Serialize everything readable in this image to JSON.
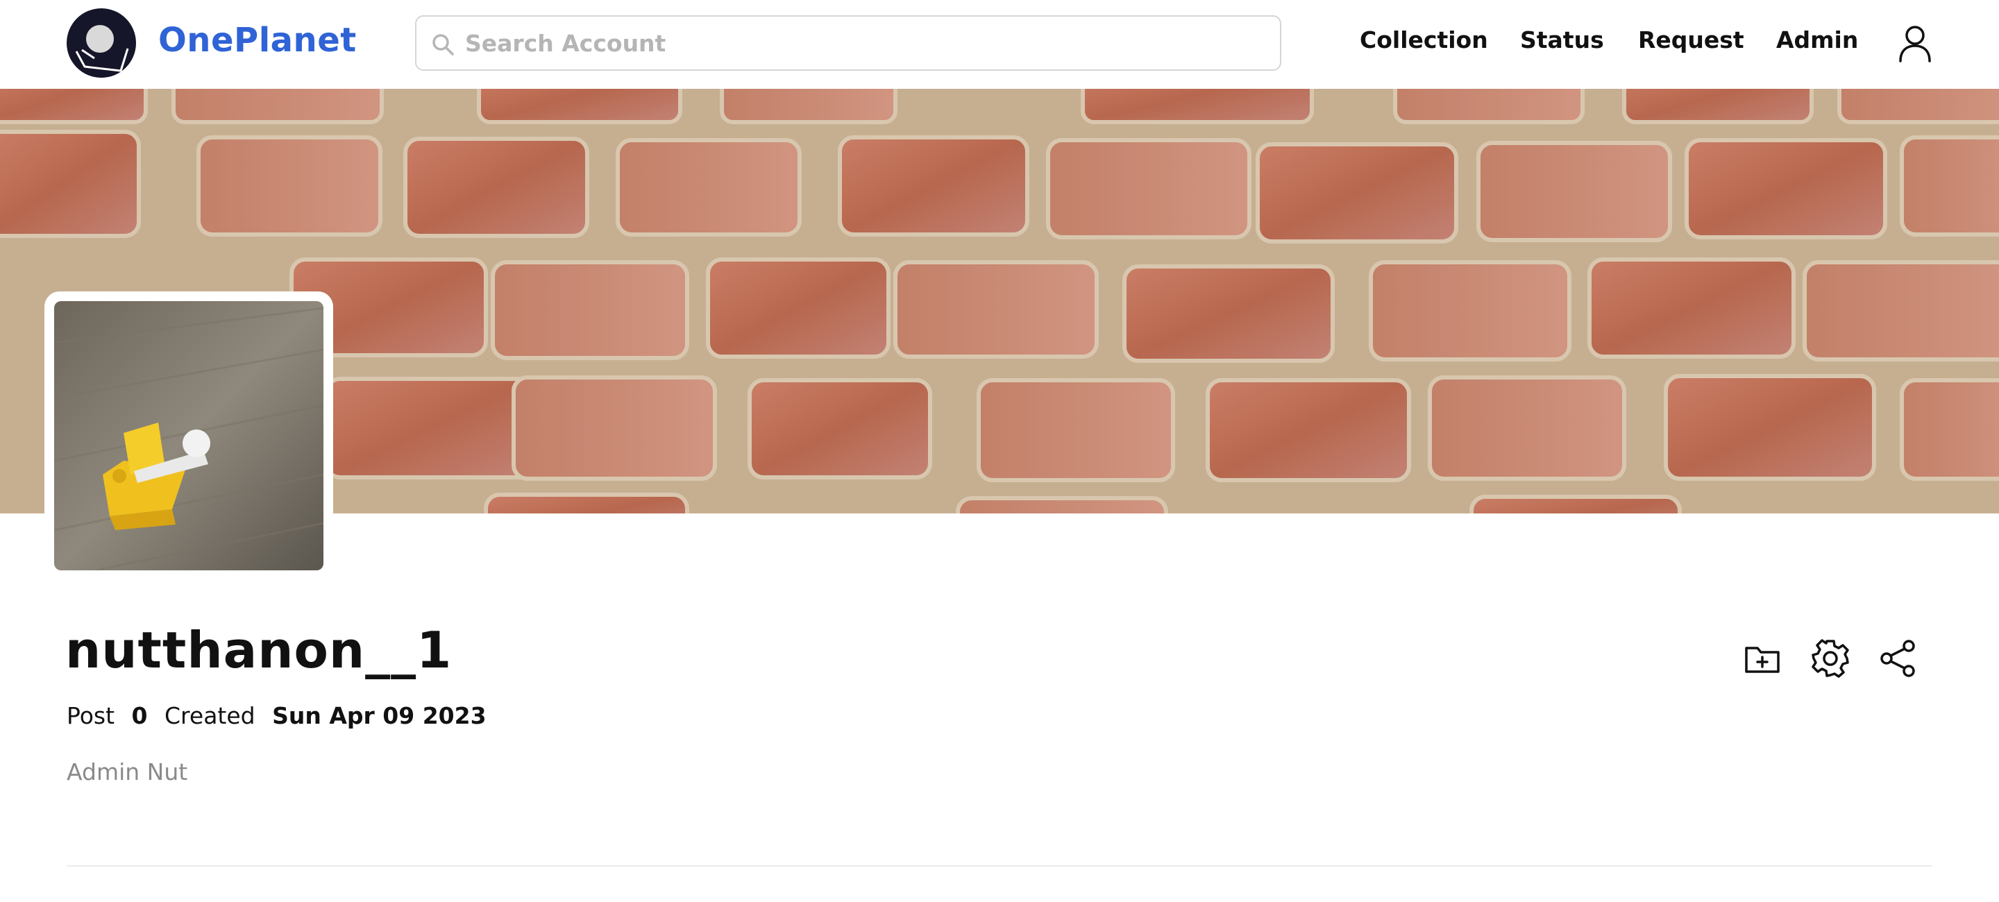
{
  "brand": {
    "name": "OnePlanet",
    "color": "#2f63d6",
    "logo_icon": "planet-logo-icon"
  },
  "search": {
    "placeholder": "Search Account",
    "value": "",
    "icon": "search-icon"
  },
  "nav": {
    "items": [
      {
        "label": "Collection"
      },
      {
        "label": "Status"
      },
      {
        "label": "Request"
      },
      {
        "label": "Admin"
      }
    ],
    "user_icon": "user-icon"
  },
  "banner": {
    "image": "brick-wall-cover"
  },
  "profile": {
    "avatar": "yellow-lego-duck-photo",
    "username": "nutthanon__1",
    "post_label": "Post",
    "post_count": "0",
    "created_label": "Created",
    "created_date": "Sun Apr 09 2023",
    "bio": "Admin Nut"
  },
  "actions": [
    {
      "name": "add-folder-button",
      "icon": "folder-plus-icon"
    },
    {
      "name": "settings-button",
      "icon": "gear-icon"
    },
    {
      "name": "share-button",
      "icon": "share-icon"
    }
  ]
}
